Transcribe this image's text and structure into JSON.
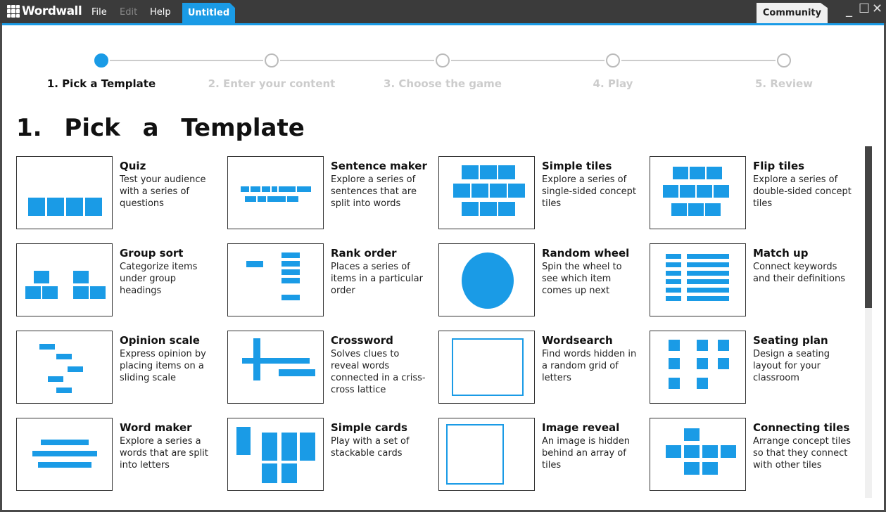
{
  "app": {
    "name": "Wordwall",
    "menu": [
      "File",
      "Edit",
      "Help"
    ],
    "tab_active": "Untitled",
    "tab_community": "Community"
  },
  "window_controls": [
    "minimize-icon",
    "maximize-icon",
    "close-icon"
  ],
  "colors": {
    "accent": "#1a9be6",
    "titlebar": "#3b3b3b"
  },
  "steps": [
    {
      "label": "1. Pick a Template",
      "active": true
    },
    {
      "label": "2. Enter your content",
      "active": false
    },
    {
      "label": "3. Choose the game",
      "active": false
    },
    {
      "label": "4. Play",
      "active": false
    },
    {
      "label": "5. Review",
      "active": false
    }
  ],
  "heading": "1.  Pick a Template",
  "templates": [
    {
      "title": "Quiz",
      "desc": "Test your audience with a series of questions"
    },
    {
      "title": "Sentence maker",
      "desc": "Explore a series of sentences that are split into words"
    },
    {
      "title": "Simple tiles",
      "desc": "Explore a series of single-sided concept tiles"
    },
    {
      "title": "Flip tiles",
      "desc": "Explore a series of double-sided concept tiles"
    },
    {
      "title": "Group sort",
      "desc": "Categorize items under group headings"
    },
    {
      "title": "Rank order",
      "desc": "Places a series of items in a particular order"
    },
    {
      "title": "Random wheel",
      "desc": "Spin the wheel to see which item comes up next"
    },
    {
      "title": "Match up",
      "desc": "Connect keywords and their definitions"
    },
    {
      "title": "Opinion scale",
      "desc": "Express opinion by placing items on a sliding scale"
    },
    {
      "title": "Crossword",
      "desc": "Solves clues to reveal words connected in a criss-cross lattice"
    },
    {
      "title": "Wordsearch",
      "desc": "Find words hidden in a random grid of letters"
    },
    {
      "title": "Seating plan",
      "desc": "Design a seating layout for your classroom"
    },
    {
      "title": "Word maker",
      "desc": "Explore a series a words that are split into letters"
    },
    {
      "title": "Simple cards",
      "desc": "Play with a set of stackable cards"
    },
    {
      "title": "Image reveal",
      "desc": "An image is hidden behind an array of tiles"
    },
    {
      "title": "Connecting tiles",
      "desc": "Arrange concept tiles so that they connect with other tiles"
    }
  ]
}
